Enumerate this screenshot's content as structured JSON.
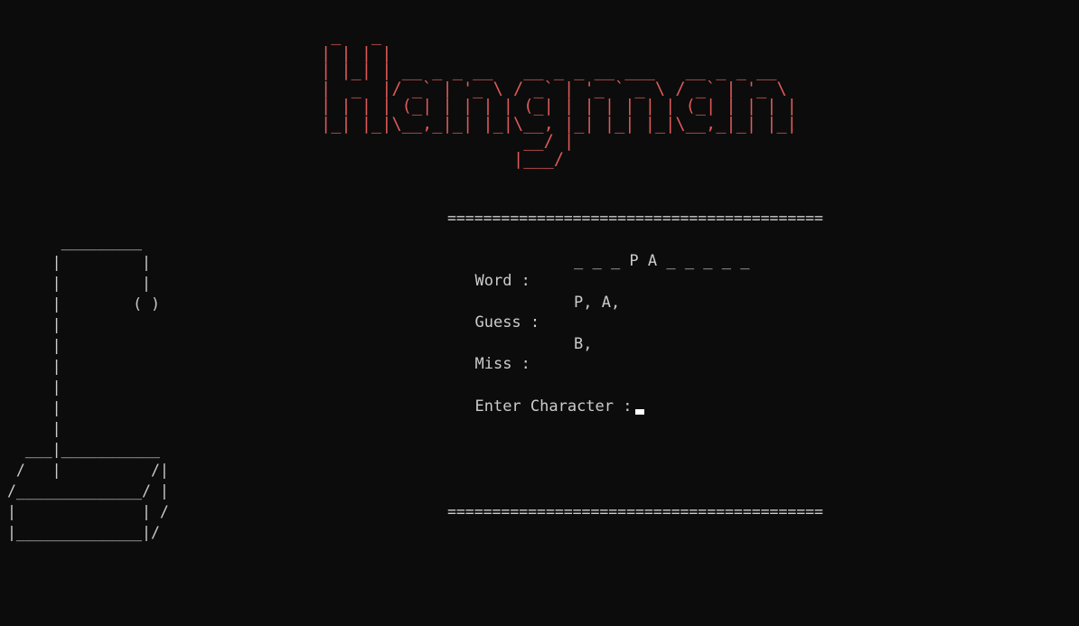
{
  "title_art": " _   _\n| | | |\n| |_| | __ _ _ __   __ _ _ __ ___   __ _ _ __\n|  _  |/ _` | '_ \\ / _` | '_ ` _ \\ / _` | '_ \\\n| | | | (_| | | | | (_| | | | | | | (_| | | | |\n|_| |_|\\__,_|_| |_|\\__, |_| |_| |_|\\__,_|_| |_|\n                    __/ |\n                   |___/",
  "gallows_art": "      _________\n     |         |\n     |         |\n     |        ( )\n     |\n     |\n     |\n     |\n     |\n     |\n  ___|___________\n /   |          /|\n/______________/ |\n|              | /\n|______________|/",
  "separator": "==========================================",
  "game": {
    "word_label": "Word :",
    "word_value": "_ _ _ P A _ _ _ _ _",
    "guess_label": "Guess :",
    "guess_value": "P, A,",
    "miss_label": "Miss :",
    "miss_value": "B,",
    "prompt_label": "Enter Character :"
  },
  "colors": {
    "background": "#0c0c0c",
    "text": "#cccccc",
    "title": "#e05a5a",
    "cursor": "#ffffff"
  }
}
